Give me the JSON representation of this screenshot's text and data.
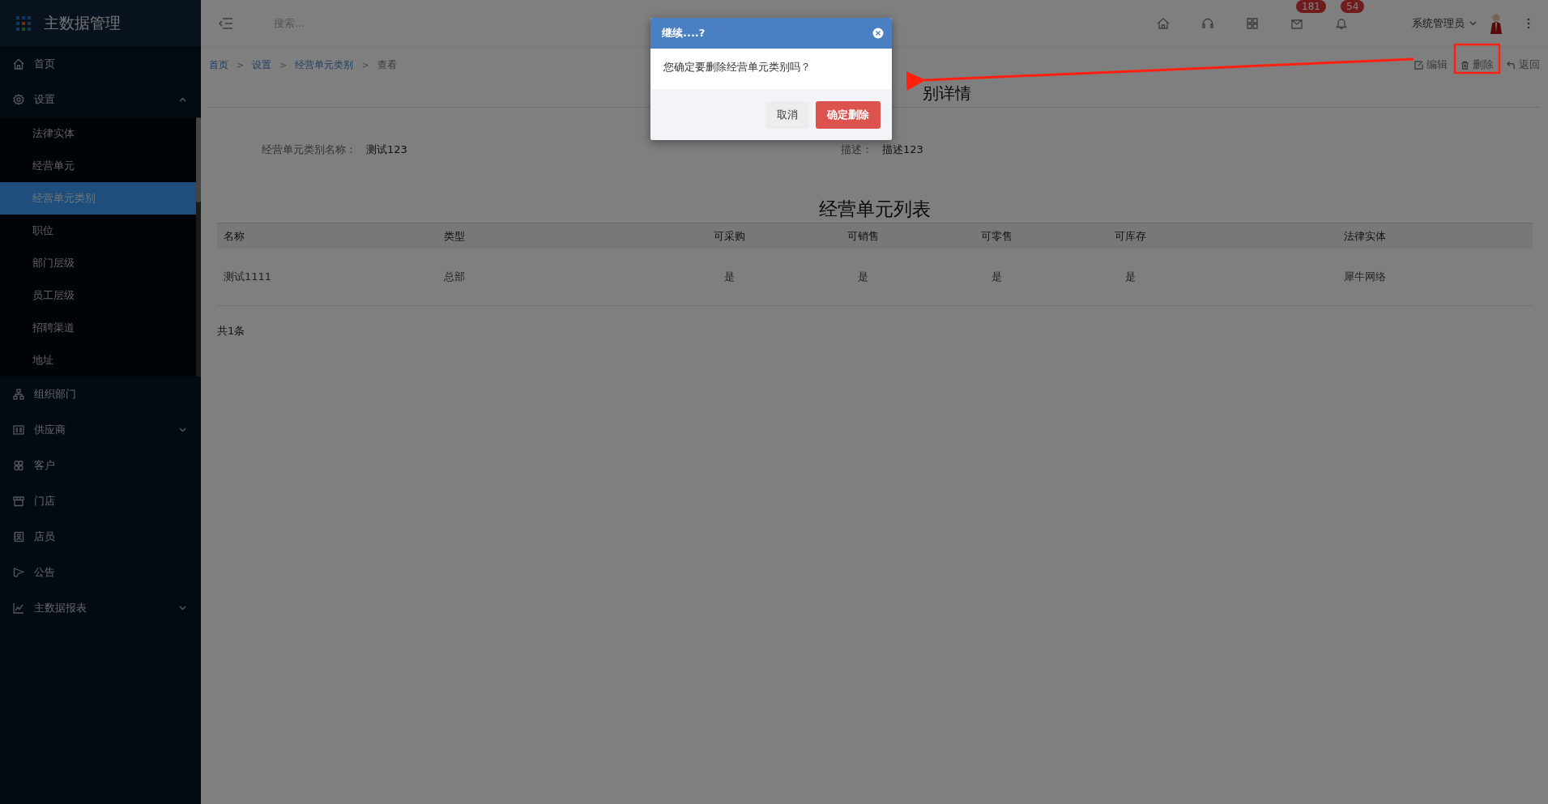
{
  "app": {
    "title": "主数据管理"
  },
  "sidebar": {
    "items": [
      {
        "label": "首页"
      },
      {
        "label": "设置",
        "expanded": true,
        "children": [
          {
            "label": "法律实体",
            "selected": false
          },
          {
            "label": "经营单元",
            "selected": false
          },
          {
            "label": "经营单元类别",
            "selected": true
          },
          {
            "label": "职位",
            "selected": false
          },
          {
            "label": "部门层级",
            "selected": false
          },
          {
            "label": "员工层级",
            "selected": false
          },
          {
            "label": "招聘渠道",
            "selected": false
          },
          {
            "label": "地址",
            "selected": false
          }
        ]
      },
      {
        "label": "组织部门"
      },
      {
        "label": "供应商",
        "expanded": false,
        "has_caret": true
      },
      {
        "label": "客户"
      },
      {
        "label": "门店"
      },
      {
        "label": "店员"
      },
      {
        "label": "公告"
      },
      {
        "label": "主数据报表",
        "expanded": false,
        "has_caret": true
      }
    ]
  },
  "topbar": {
    "search": {
      "placeholder": "搜索..."
    },
    "icons": [
      {
        "kind": "home"
      },
      {
        "kind": "headset"
      },
      {
        "kind": "grid"
      },
      {
        "kind": "mail",
        "badge": "181"
      },
      {
        "kind": "bell",
        "badge": "54"
      }
    ],
    "user": "系统管理员"
  },
  "breadcrumb": [
    {
      "label": "首页",
      "current": false
    },
    {
      "prefix": ">",
      "label": "设置",
      "current": false
    },
    {
      "prefix": ">",
      "label": "经营单元类别",
      "current": false
    },
    {
      "prefix": ">",
      "label": "查看",
      "current": true
    }
  ],
  "actions": [
    {
      "kind": "edit",
      "label": "编辑"
    },
    {
      "kind": "delete",
      "label": "删除"
    },
    {
      "kind": "back",
      "label": "返回"
    }
  ],
  "page_title": "别详情",
  "fields": [
    {
      "label": "经营单元类别名称：",
      "value": "测试123"
    },
    {
      "label": "描述：",
      "value": "描述123"
    }
  ],
  "table": {
    "title": "经营单元列表",
    "columns": [
      "名称",
      "类型",
      "可采购",
      "可销售",
      "可零售",
      "可库存",
      "法律实体"
    ],
    "rows": [
      [
        "测试1111",
        "总部",
        "是",
        "是",
        "是",
        "是",
        "犀牛网络"
      ]
    ],
    "footer": "共1条"
  },
  "dialog": {
    "title": "继续....?",
    "message": "您确定要删除经营单元类别吗？",
    "buttons": [
      {
        "kind": "cancel",
        "label": "取消"
      },
      {
        "kind": "confirm",
        "label": "确定删除"
      }
    ]
  }
}
